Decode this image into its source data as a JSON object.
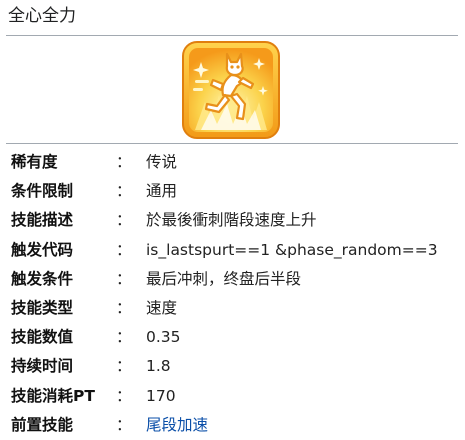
{
  "page": {
    "title": "全心全力"
  },
  "skill_icon": {
    "name": "running-figure-icon",
    "colors": {
      "frame": "#f7b21c",
      "frame_dark": "#e58a10",
      "inner": "#fbe56a",
      "glow": "#fff3a0",
      "burst": "#ffd74a",
      "figure": "#ffffff",
      "figure_stroke": "#ef9c1f"
    }
  },
  "rows": [
    {
      "label": "稀有度",
      "colon": "：",
      "value": "传说"
    },
    {
      "label": "条件限制",
      "colon": "：",
      "value": "通用"
    },
    {
      "label": "技能描述",
      "colon": "：",
      "value": "於最後衝刺階段速度上升"
    },
    {
      "label": "触发代码",
      "colon": "：",
      "value": "is_lastspurt==1 &phase_random==3"
    },
    {
      "label": "触发条件",
      "colon": "：",
      "value": "最后冲刺，终盘后半段"
    },
    {
      "label": "技能类型",
      "colon": "：",
      "value": "速度"
    },
    {
      "label": "技能数值",
      "colon": "：",
      "value": "0.35"
    },
    {
      "label": "持续时间",
      "colon": "：",
      "value": "1.8"
    },
    {
      "label": "技能消耗PT",
      "colon": "：",
      "value": "170"
    },
    {
      "label": "前置技能",
      "colon": "：",
      "value": "尾段加速"
    }
  ],
  "colors": {
    "link": "#0b4fa8",
    "divider": "#a2a9b1"
  }
}
